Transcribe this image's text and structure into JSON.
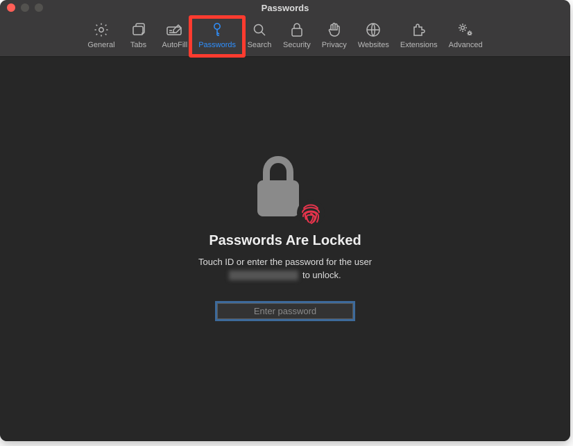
{
  "window": {
    "title": "Passwords"
  },
  "tabs": [
    {
      "id": "general",
      "label": "General"
    },
    {
      "id": "tabs",
      "label": "Tabs"
    },
    {
      "id": "autofill",
      "label": "AutoFill"
    },
    {
      "id": "passwords",
      "label": "Passwords",
      "active": true,
      "highlighted": true
    },
    {
      "id": "search",
      "label": "Search"
    },
    {
      "id": "security",
      "label": "Security"
    },
    {
      "id": "privacy",
      "label": "Privacy"
    },
    {
      "id": "websites",
      "label": "Websites"
    },
    {
      "id": "extensions",
      "label": "Extensions"
    },
    {
      "id": "advanced",
      "label": "Advanced"
    }
  ],
  "locked": {
    "heading": "Passwords Are Locked",
    "sub_prefix": "Touch ID or enter the password for the user",
    "username_redacted": true,
    "sub_suffix": " to unlock.",
    "placeholder": "Enter password",
    "value": ""
  },
  "colors": {
    "accent": "#2f90ff",
    "highlight": "#ff3b2f",
    "fingerprint": "#e7344c"
  }
}
